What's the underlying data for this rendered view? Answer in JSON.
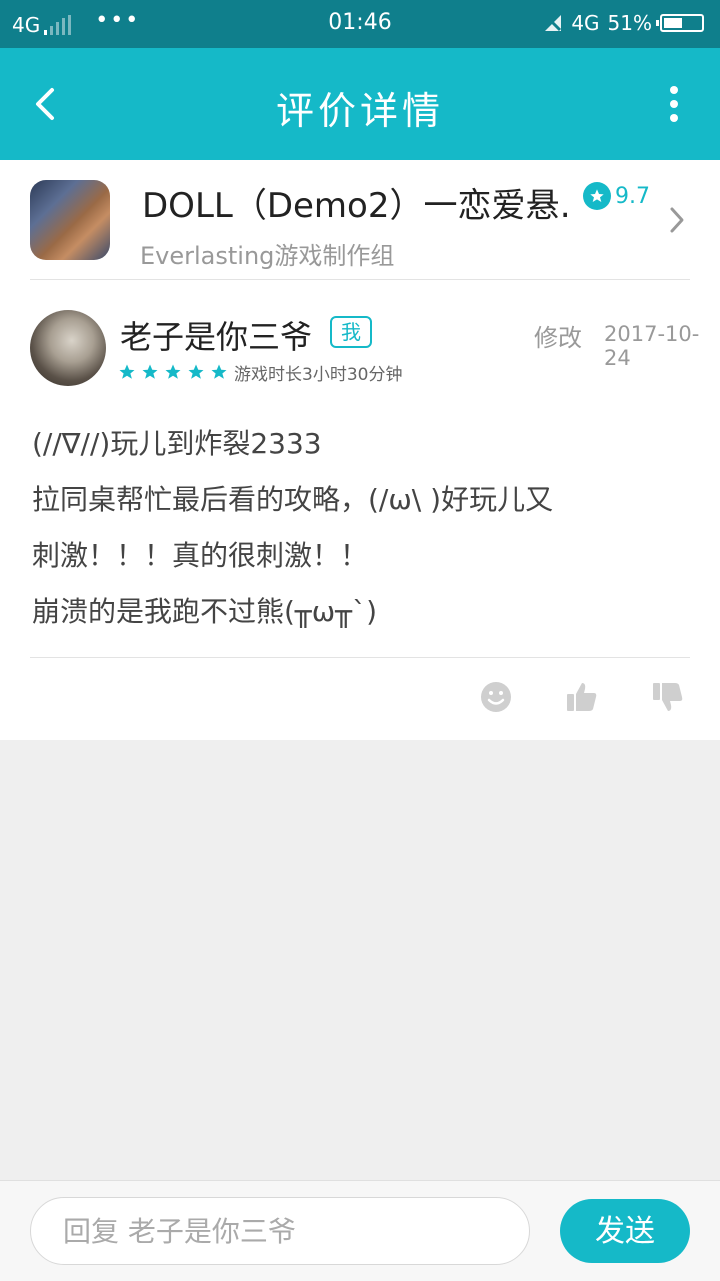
{
  "status_bar": {
    "network_left": "4G",
    "dots": "•••",
    "time": "01:46",
    "network_right": "4G",
    "battery": "51%",
    "battery_level": 0.51
  },
  "header": {
    "title": "评价详情",
    "back_icon": "chevron-left-icon",
    "more_icon": "more-vertical-icon"
  },
  "game": {
    "title": "DOLL（Demo2）一恋爱悬…",
    "developer": "Everlasting游戏制作组",
    "rating": "9.7"
  },
  "review": {
    "username": "老子是你三爷",
    "me_badge": "我",
    "edit_label": "修改",
    "date": "2017-10-24",
    "star_count": 5,
    "playtime": "游戏时长3小时30分钟",
    "lines": [
      "(//∇//)玩儿到炸裂2333",
      "拉同桌帮忙最后看的攻略，(/ω\\ )好玩儿又",
      "刺激！！！真的很刺激！！",
      "崩溃的是我跑不过熊(╥ω╥`)"
    ]
  },
  "reply": {
    "placeholder": "回复 老子是你三爷",
    "send_label": "发送"
  },
  "colors": {
    "accent": "#15b9c8",
    "status_bar": "#0f7f8c",
    "background": "#efefef"
  }
}
